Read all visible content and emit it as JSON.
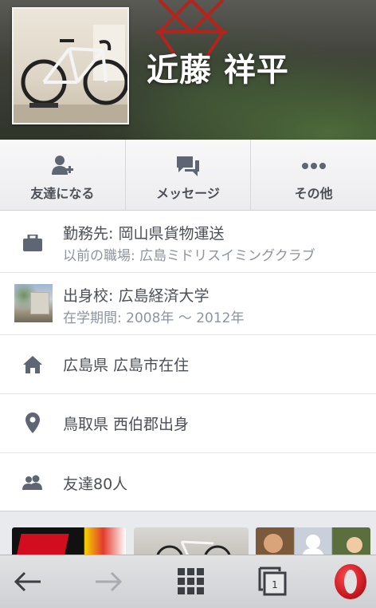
{
  "profile": {
    "name": "近藤 祥平"
  },
  "actions": [
    {
      "label": "友達になる",
      "icon": "add-friend-icon"
    },
    {
      "label": "メッセージ",
      "icon": "message-icon"
    },
    {
      "label": "その他",
      "icon": "more-icon"
    }
  ],
  "info": {
    "work": {
      "title": "勤務先: 岡山県貨物運送",
      "sub": "以前の職場: 広島ミドリスイミングクラブ",
      "icon": "briefcase-icon"
    },
    "education": {
      "title": "出身校: 広島経済大学",
      "sub": "在学期間: 2008年 ～ 2012年",
      "icon": "school-thumbnail"
    },
    "residence": {
      "title": "広島県 広島市在住",
      "icon": "home-icon"
    },
    "hometown": {
      "title": "鳥取県 西伯郡出身",
      "icon": "location-pin-icon"
    },
    "friends": {
      "title": "友達80人",
      "icon": "friends-icon"
    }
  },
  "browser": {
    "tab_count": "1",
    "icons": [
      "back-arrow-icon",
      "forward-arrow-icon",
      "speed-dial-icon",
      "tabs-icon",
      "opera-menu-icon"
    ]
  },
  "colors": {
    "text": "#4b4f56",
    "subtext": "#8d949e",
    "opera_red": "#cc0f16"
  }
}
